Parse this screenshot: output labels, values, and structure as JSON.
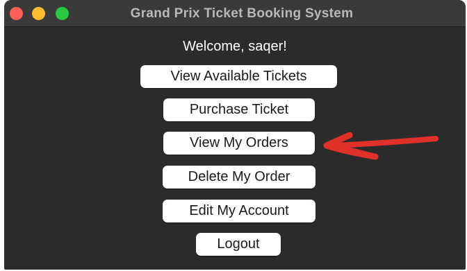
{
  "window": {
    "title": "Grand Prix Ticket Booking System",
    "traffic_lights": [
      "close",
      "minimize",
      "maximize"
    ]
  },
  "main": {
    "welcome": "Welcome, saqer!",
    "buttons": [
      "View Available Tickets",
      "Purchase Ticket",
      "View My Orders",
      "Delete My Order",
      "Edit My Account",
      "Logout"
    ]
  },
  "annotation": {
    "icon": "red-hand-drawn-arrow-icon",
    "color": "#e0302a"
  }
}
